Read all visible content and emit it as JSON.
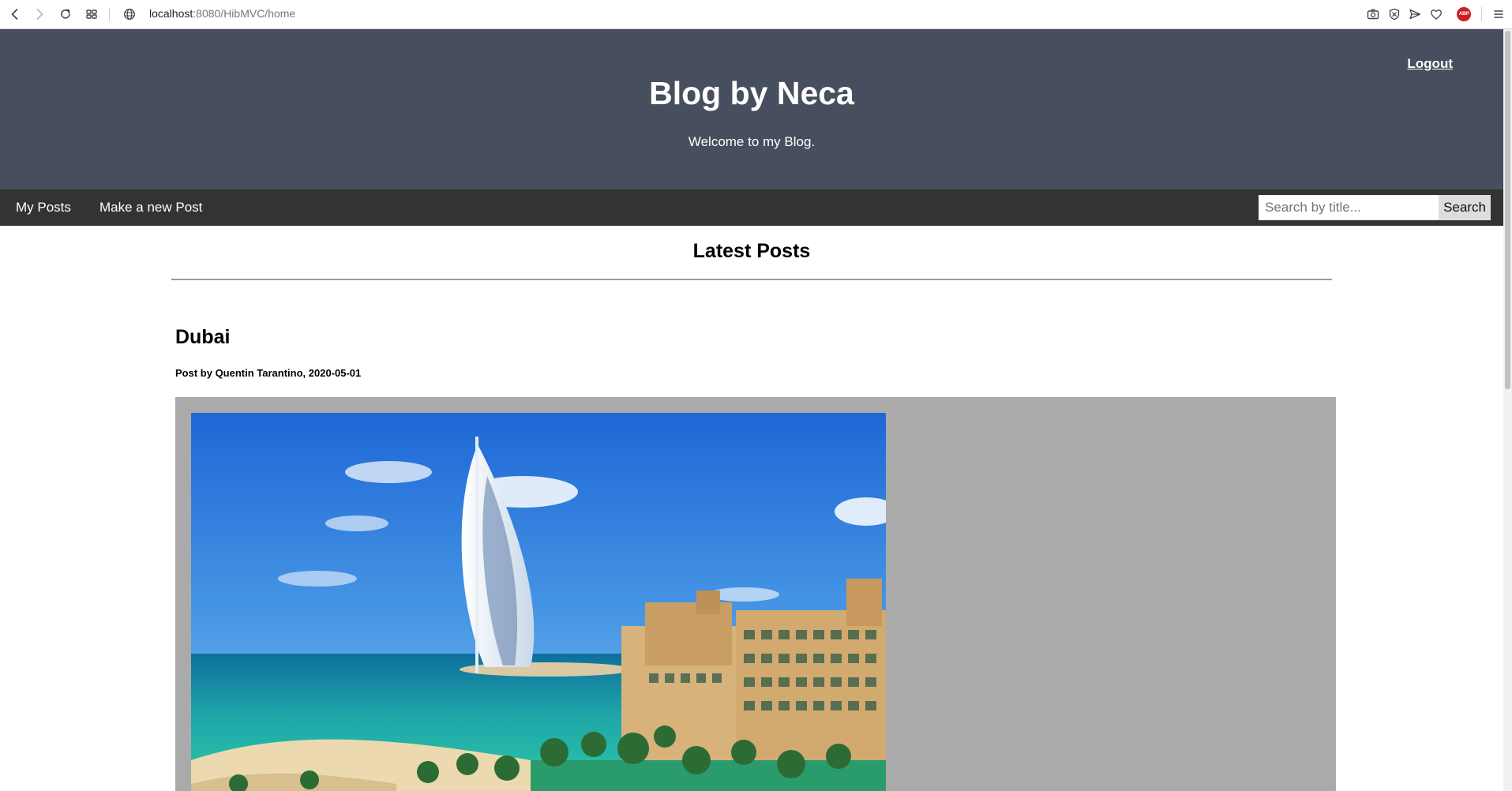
{
  "browser": {
    "url_host": "localhost",
    "url_rest": ":8080/HibMVC/home",
    "toolbar_icons": [
      "back-icon",
      "forward-icon",
      "reload-icon",
      "grid-icon",
      "globe-icon",
      "camera-icon",
      "shield-x-icon",
      "send-icon",
      "heart-icon",
      "adblock-icon",
      "menu-icon"
    ],
    "adblock_label": "ABP"
  },
  "header": {
    "title": "Blog by Neca",
    "subtitle": "Welcome to my Blog.",
    "logout_label": "Logout"
  },
  "nav": {
    "items": [
      {
        "label": "My Posts"
      },
      {
        "label": "Make a new Post"
      }
    ],
    "search": {
      "placeholder": "Search by title...",
      "value": "",
      "button_label": "Search"
    }
  },
  "main": {
    "section_title": "Latest Posts",
    "posts": [
      {
        "title": "Dubai",
        "meta": "Post by Quentin Tarantino, 2020-05-01",
        "image_subject": "Burj Al Arab hotel and Madinat Jumeirah resort"
      }
    ]
  },
  "colors": {
    "header_bg": "#474e5d",
    "navbar_bg": "#333333",
    "post_bg": "#aaaaaa",
    "search_button_bg": "#dddddd"
  }
}
